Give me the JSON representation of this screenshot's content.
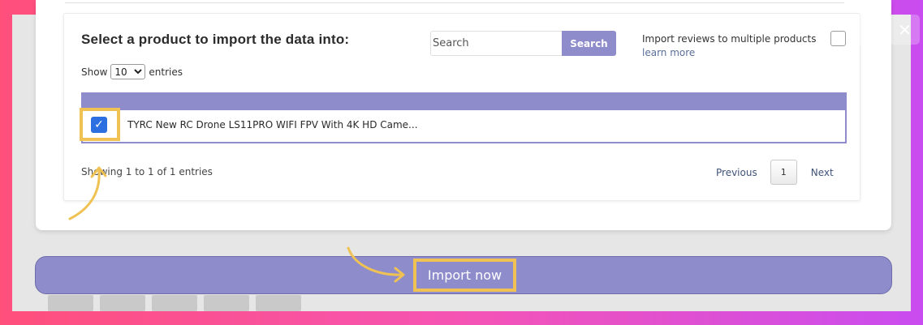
{
  "dialog": {
    "title": "Select a product to import the data into:",
    "search": {
      "placeholder": "Search",
      "button_label": "Search"
    },
    "reviews_option": {
      "label": "Import reviews to multiple products",
      "link": "learn more",
      "checked": false
    },
    "entries": {
      "prefix": "Show",
      "selected": "10",
      "suffix": "entries"
    },
    "table": {
      "rows": [
        {
          "checked": true,
          "title": "TYRC New RC Drone LS11PRO WIFI FPV With 4K HD Came..."
        }
      ]
    },
    "footer": {
      "info": "Showing 1 to 1 of 1 entries",
      "previous": "Previous",
      "page": "1",
      "next": "Next"
    }
  },
  "import_button": {
    "label": "Import now"
  },
  "corner_icons": {
    "expand": "expand-icon",
    "close": "close-icon"
  },
  "colors": {
    "accent": "#8e8ccb",
    "highlight": "#efc253",
    "checkbox": "#2b6fe0"
  }
}
